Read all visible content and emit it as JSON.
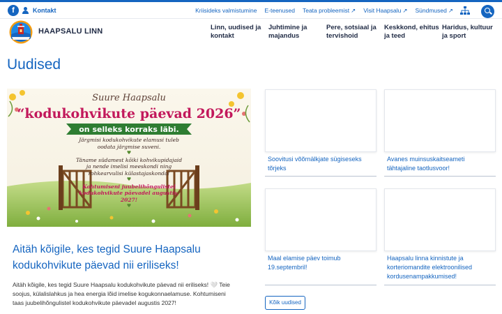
{
  "topbar": {
    "contact_label": "Kontakt",
    "utility_links": [
      {
        "label": "Kriisideks valmistumine",
        "external": false
      },
      {
        "label": "E-teenused",
        "external": false
      },
      {
        "label": "Teata probleemist",
        "external": true
      },
      {
        "label": "Visit Haapsalu",
        "external": true
      },
      {
        "label": "Sündmused",
        "external": true
      }
    ],
    "icons": [
      "facebook-icon",
      "person-icon",
      "external-link-icon",
      "sitemap-icon",
      "search-icon"
    ]
  },
  "header": {
    "site_name": "HAAPSALU LINN",
    "logo_text": "HAAPSALU 1279",
    "nav": [
      {
        "line1": "Linn, uudised ja",
        "line2": "kontakt"
      },
      {
        "line1": "Juhtimine ja",
        "line2": "majandus"
      },
      {
        "line1": "Pere, sotsiaal ja",
        "line2": "tervishoid"
      },
      {
        "line1": "Keskkond, ehitus",
        "line2": "ja teed"
      },
      {
        "line1": "Haridus, kultuur",
        "line2": "ja sport"
      }
    ]
  },
  "page": {
    "title": "Uudised",
    "all_news_label": "Kõik uudised"
  },
  "featured": {
    "image": {
      "heading_small": "Suure Haapsalu",
      "heading_big": "“kodukohvikute päevad 2026”",
      "ribbon": "on selleks korraks läbi.",
      "text1": "Järgmisi kodukohvikute elamusi tuleb oodata järgmise suveni.",
      "text2": "Täname südamest kõiki kohvikupidajaid ja nende imelisi meeskondi ning rohkearvulisi külastajaskonda!",
      "text3": "Kohtumiseni juubelihõngulistel kodukohvikute päevadel augustis, 2027!"
    },
    "title": "Aitäh kõigile, kes tegid Suure Haapsalu kodukohvikute päevad nii eriliseks!",
    "excerpt": "Aitäh kõigile, kes tegid Suure Haapsalu kodukohvikute päevad nii eriliseks! 🤍 Teie soojus, külalislahkus ja hea energia lõid imelise kogukonnaelamuse. Kohtumiseni taas juubelihõngulistel kodukohvikute päevadel augustis 2027!"
  },
  "news_cards": [
    {
      "title": "Soovitusi võõrnälkjate sügiseseks tõrjeks"
    },
    {
      "title": "Avanes muinsuskaitseameti tähtajaline taotlusvoor!"
    },
    {
      "title": "Maal elamise päev toimub 19.septembril!"
    },
    {
      "title": "Haapsalu linna kinnistute ja korteriomandite elektroonilised kordusenampakkumised!"
    }
  ],
  "colors": {
    "accent": "#1565c0",
    "text_dark": "#1f2a44",
    "poster_green": "#2e7d32",
    "poster_pink": "#d81b60"
  }
}
